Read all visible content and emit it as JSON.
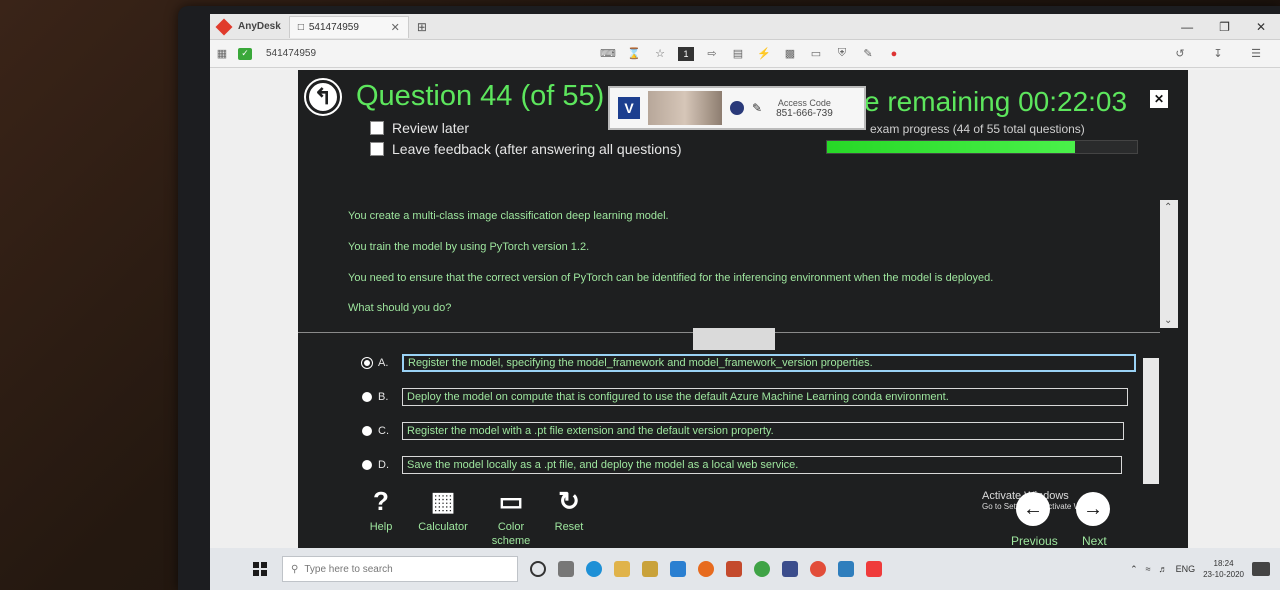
{
  "anydesk": {
    "app_name": "AnyDesk",
    "tab_id": "541474959",
    "toolbar_id": "541474959"
  },
  "exam": {
    "title": "Question 44 (of 55)",
    "review_later": "Review later",
    "leave_feedback": "Leave feedback (after answering all questions)",
    "time_remaining": "e remaining 00:22:03",
    "progress_text": "exam progress (44 of 55 total questions)",
    "progress_fraction": 0.8
  },
  "popup": {
    "logo_letter": "V",
    "access_code_label": "Access Code",
    "access_code": "851-666-739"
  },
  "question": {
    "lines": [
      "You create a multi-class image classification deep learning model.",
      "You train the model by using PyTorch version 1.2.",
      "You need to ensure that the correct version of PyTorch can be identified for the inferencing environment when the model is deployed.",
      "What should you do?"
    ]
  },
  "options": [
    {
      "letter": "A.",
      "text": "Register the model, specifying the model_framework and model_framework_version properties.",
      "selected": true
    },
    {
      "letter": "B.",
      "text": "Deploy the model on compute that is configured to use the default Azure Machine Learning conda environment.",
      "selected": false
    },
    {
      "letter": "C.",
      "text": "Register the model with a .pt file extension and the default version property.",
      "selected": false
    },
    {
      "letter": "D.",
      "text": "Save the model locally as a .pt file, and deploy the model as a local web service.",
      "selected": false
    }
  ],
  "tools": {
    "help": "Help",
    "calculator": "Calculator",
    "color_scheme": "Color scheme",
    "reset": "Reset"
  },
  "nav": {
    "previous": "Previous",
    "next": "Next"
  },
  "watermark": {
    "title": "Activate Windows",
    "subtitle": "Go to Settings to activate Windows."
  },
  "taskbar": {
    "search_placeholder": "Type here to search",
    "language": "ENG",
    "time": "18:24",
    "date": "23-10-2020"
  }
}
